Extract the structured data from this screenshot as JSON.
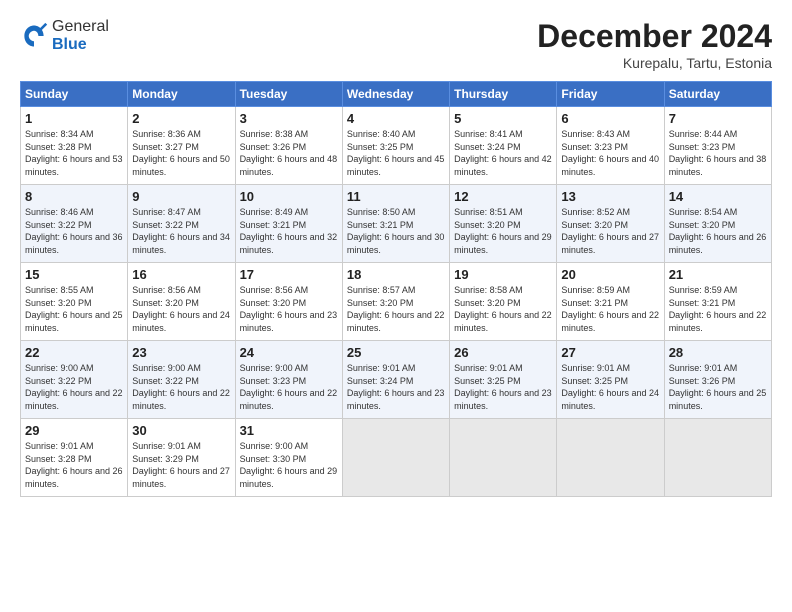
{
  "logo": {
    "line1": "General",
    "line2": "Blue"
  },
  "header": {
    "title": "December 2024",
    "subtitle": "Kurepalu, Tartu, Estonia"
  },
  "weekdays": [
    "Sunday",
    "Monday",
    "Tuesday",
    "Wednesday",
    "Thursday",
    "Friday",
    "Saturday"
  ],
  "weeks": [
    [
      {
        "day": 1,
        "sunrise": "8:34 AM",
        "sunset": "3:28 PM",
        "daylight": "6 hours and 53 minutes."
      },
      {
        "day": 2,
        "sunrise": "8:36 AM",
        "sunset": "3:27 PM",
        "daylight": "6 hours and 50 minutes."
      },
      {
        "day": 3,
        "sunrise": "8:38 AM",
        "sunset": "3:26 PM",
        "daylight": "6 hours and 48 minutes."
      },
      {
        "day": 4,
        "sunrise": "8:40 AM",
        "sunset": "3:25 PM",
        "daylight": "6 hours and 45 minutes."
      },
      {
        "day": 5,
        "sunrise": "8:41 AM",
        "sunset": "3:24 PM",
        "daylight": "6 hours and 42 minutes."
      },
      {
        "day": 6,
        "sunrise": "8:43 AM",
        "sunset": "3:23 PM",
        "daylight": "6 hours and 40 minutes."
      },
      {
        "day": 7,
        "sunrise": "8:44 AM",
        "sunset": "3:23 PM",
        "daylight": "6 hours and 38 minutes."
      }
    ],
    [
      {
        "day": 8,
        "sunrise": "8:46 AM",
        "sunset": "3:22 PM",
        "daylight": "6 hours and 36 minutes."
      },
      {
        "day": 9,
        "sunrise": "8:47 AM",
        "sunset": "3:22 PM",
        "daylight": "6 hours and 34 minutes."
      },
      {
        "day": 10,
        "sunrise": "8:49 AM",
        "sunset": "3:21 PM",
        "daylight": "6 hours and 32 minutes."
      },
      {
        "day": 11,
        "sunrise": "8:50 AM",
        "sunset": "3:21 PM",
        "daylight": "6 hours and 30 minutes."
      },
      {
        "day": 12,
        "sunrise": "8:51 AM",
        "sunset": "3:20 PM",
        "daylight": "6 hours and 29 minutes."
      },
      {
        "day": 13,
        "sunrise": "8:52 AM",
        "sunset": "3:20 PM",
        "daylight": "6 hours and 27 minutes."
      },
      {
        "day": 14,
        "sunrise": "8:54 AM",
        "sunset": "3:20 PM",
        "daylight": "6 hours and 26 minutes."
      }
    ],
    [
      {
        "day": 15,
        "sunrise": "8:55 AM",
        "sunset": "3:20 PM",
        "daylight": "6 hours and 25 minutes."
      },
      {
        "day": 16,
        "sunrise": "8:56 AM",
        "sunset": "3:20 PM",
        "daylight": "6 hours and 24 minutes."
      },
      {
        "day": 17,
        "sunrise": "8:56 AM",
        "sunset": "3:20 PM",
        "daylight": "6 hours and 23 minutes."
      },
      {
        "day": 18,
        "sunrise": "8:57 AM",
        "sunset": "3:20 PM",
        "daylight": "6 hours and 22 minutes."
      },
      {
        "day": 19,
        "sunrise": "8:58 AM",
        "sunset": "3:20 PM",
        "daylight": "6 hours and 22 minutes."
      },
      {
        "day": 20,
        "sunrise": "8:59 AM",
        "sunset": "3:21 PM",
        "daylight": "6 hours and 22 minutes."
      },
      {
        "day": 21,
        "sunrise": "8:59 AM",
        "sunset": "3:21 PM",
        "daylight": "6 hours and 22 minutes."
      }
    ],
    [
      {
        "day": 22,
        "sunrise": "9:00 AM",
        "sunset": "3:22 PM",
        "daylight": "6 hours and 22 minutes."
      },
      {
        "day": 23,
        "sunrise": "9:00 AM",
        "sunset": "3:22 PM",
        "daylight": "6 hours and 22 minutes."
      },
      {
        "day": 24,
        "sunrise": "9:00 AM",
        "sunset": "3:23 PM",
        "daylight": "6 hours and 22 minutes."
      },
      {
        "day": 25,
        "sunrise": "9:01 AM",
        "sunset": "3:24 PM",
        "daylight": "6 hours and 23 minutes."
      },
      {
        "day": 26,
        "sunrise": "9:01 AM",
        "sunset": "3:25 PM",
        "daylight": "6 hours and 23 minutes."
      },
      {
        "day": 27,
        "sunrise": "9:01 AM",
        "sunset": "3:25 PM",
        "daylight": "6 hours and 24 minutes."
      },
      {
        "day": 28,
        "sunrise": "9:01 AM",
        "sunset": "3:26 PM",
        "daylight": "6 hours and 25 minutes."
      }
    ],
    [
      {
        "day": 29,
        "sunrise": "9:01 AM",
        "sunset": "3:28 PM",
        "daylight": "6 hours and 26 minutes."
      },
      {
        "day": 30,
        "sunrise": "9:01 AM",
        "sunset": "3:29 PM",
        "daylight": "6 hours and 27 minutes."
      },
      {
        "day": 31,
        "sunrise": "9:00 AM",
        "sunset": "3:30 PM",
        "daylight": "6 hours and 29 minutes."
      },
      null,
      null,
      null,
      null
    ]
  ]
}
